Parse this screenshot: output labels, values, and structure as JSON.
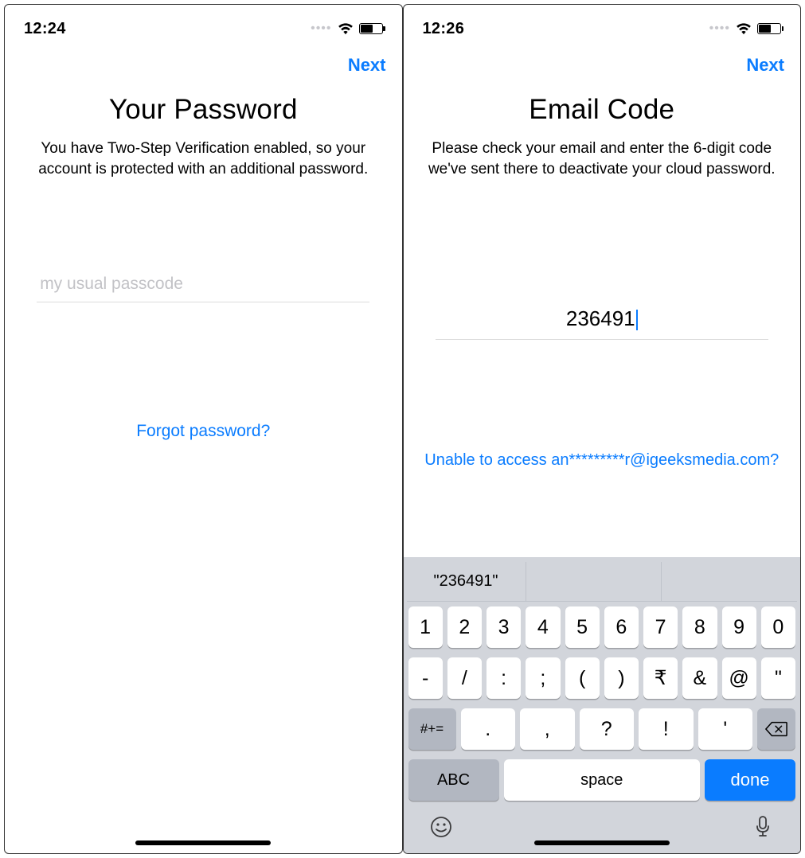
{
  "left": {
    "status": {
      "time": "12:24"
    },
    "nav": {
      "next": "Next"
    },
    "title": "Your Password",
    "subtitle": "You have Two-Step Verification enabled, so your account is protected with an additional password.",
    "input": {
      "placeholder": "my usual passcode",
      "value": ""
    },
    "forgot": "Forgot password?"
  },
  "right": {
    "status": {
      "time": "12:26"
    },
    "nav": {
      "next": "Next"
    },
    "title": "Email Code",
    "subtitle": "Please check your email and enter the 6-digit code we've sent there to deactivate your cloud password.",
    "code": "236491",
    "unable": "Unable to access an*********r@igeeksmedia.com?",
    "keyboard": {
      "suggestion": "\"236491\"",
      "row1": [
        "1",
        "2",
        "3",
        "4",
        "5",
        "6",
        "7",
        "8",
        "9",
        "0"
      ],
      "row2": [
        "-",
        "/",
        ":",
        ";",
        "(",
        ")",
        "₹",
        "&",
        "@",
        "\""
      ],
      "row3_mod": "#+=",
      "row3_keys": [
        ".",
        ",",
        "?",
        "!",
        "'"
      ],
      "abc": "ABC",
      "space": "space",
      "done": "done"
    }
  }
}
